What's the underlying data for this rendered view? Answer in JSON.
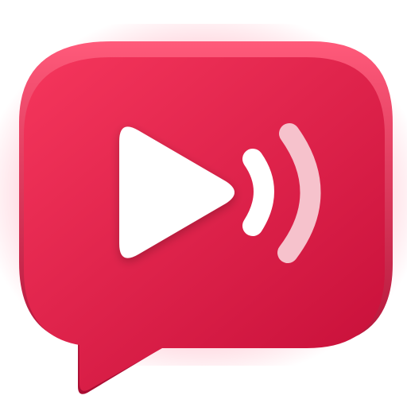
{
  "icon": {
    "name": "video-chat-app-icon",
    "symbols": [
      "speech-bubble-icon",
      "play-icon",
      "sound-wave-icon"
    ],
    "colors": {
      "bubble_top": "#f5365c",
      "bubble_bottom": "#c8103a",
      "bubble_edge": "#b30e34",
      "glow": "#ff6f8c",
      "play": "#ffffff",
      "wave_inner": "#ffffff",
      "wave_outer": "#f6c2cc"
    }
  }
}
